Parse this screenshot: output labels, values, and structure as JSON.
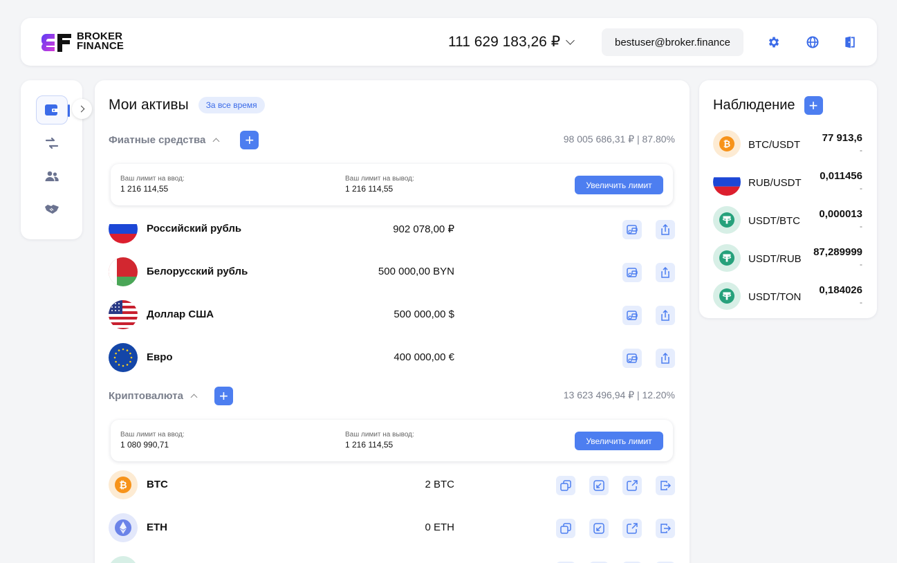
{
  "header": {
    "logo_line1": "BROKER",
    "logo_line2": "FINANCE",
    "balance": "111 629 183,26 ₽",
    "email": "bestuser@broker.finance",
    "icons": [
      "gear-icon",
      "globe-icon",
      "logout-icon"
    ]
  },
  "sidebar": {
    "items": [
      "wallet-icon",
      "exchange-icon",
      "users-icon",
      "handshake-icon"
    ]
  },
  "assets": {
    "title": "Мои активы",
    "period": "За все время",
    "fiat": {
      "title": "Фиатные средства",
      "total": "98 005 686,31 ₽ | 87.80%",
      "limit_in_label": "Ваш лимит на ввод:",
      "limit_in_value": "1 216 114,55",
      "limit_out_label": "Ваш лимит на вывод:",
      "limit_out_value": "1 216 114,55",
      "raise_label": "Увеличить лимит",
      "items": [
        {
          "name": "Российский рубль",
          "amount": "902 078,00 ₽"
        },
        {
          "name": "Белорусский рубль",
          "amount": "500 000,00 BYN"
        },
        {
          "name": "Доллар США",
          "amount": "500 000,00 $"
        },
        {
          "name": "Евро",
          "amount": "400 000,00 €"
        }
      ]
    },
    "crypto": {
      "title": "Криптовалюта",
      "total": "13 623 496,94 ₽ | 12.20%",
      "limit_in_label": "Ваш лимит на ввод:",
      "limit_in_value": "1 080 990,71",
      "limit_out_label": "Ваш лимит на вывод:",
      "limit_out_value": "1 216 114,55",
      "raise_label": "Увеличить лимит",
      "items": [
        {
          "name": "BTC",
          "amount": "2 BTC"
        },
        {
          "name": "ETH",
          "amount": "0 ETH"
        }
      ]
    }
  },
  "watchlist": {
    "title": "Наблюдение",
    "items": [
      {
        "pair": "BTC/USDT",
        "price": "77 913,6",
        "change": "-"
      },
      {
        "pair": "RUB/USDT",
        "price": "0,011456",
        "change": "-"
      },
      {
        "pair": "USDT/BTC",
        "price": "0,000013",
        "change": "-"
      },
      {
        "pair": "USDT/RUB",
        "price": "87,289999",
        "change": "-"
      },
      {
        "pair": "USDT/TON",
        "price": "0,184026",
        "change": "-"
      }
    ]
  },
  "colors": {
    "accent": "#4d7ef0",
    "accent_light": "#e6edfd",
    "muted_text": "#7a7f8c",
    "background": "#f4f5f7"
  }
}
